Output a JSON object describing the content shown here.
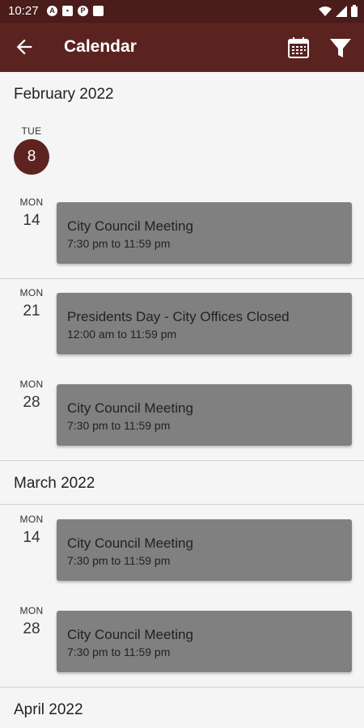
{
  "status": {
    "time": "10:27"
  },
  "appbar": {
    "title": "Calendar"
  },
  "today": {
    "dow": "TUE",
    "day": "8"
  },
  "months": [
    "February 2022",
    "March 2022",
    "April 2022"
  ],
  "events": [
    {
      "dow": "MON",
      "day": "14",
      "title": "City Council Meeting",
      "time": "7:30 pm to 11:59 pm"
    },
    {
      "dow": "MON",
      "day": "21",
      "title": "Presidents Day - City Offices Closed",
      "time": "12:00 am to 11:59 pm"
    },
    {
      "dow": "MON",
      "day": "28",
      "title": "City Council Meeting",
      "time": "7:30 pm to 11:59 pm"
    },
    {
      "dow": "MON",
      "day": "14",
      "title": "City Council Meeting",
      "time": "7:30 pm to 11:59 pm"
    },
    {
      "dow": "MON",
      "day": "28",
      "title": "City Council Meeting",
      "time": "7:30 pm to 11:59 pm"
    }
  ],
  "colors": {
    "appbar": "#5a2320",
    "statusbar": "#4a1c1a",
    "today": "#5e2321",
    "event_card": "#808080"
  }
}
